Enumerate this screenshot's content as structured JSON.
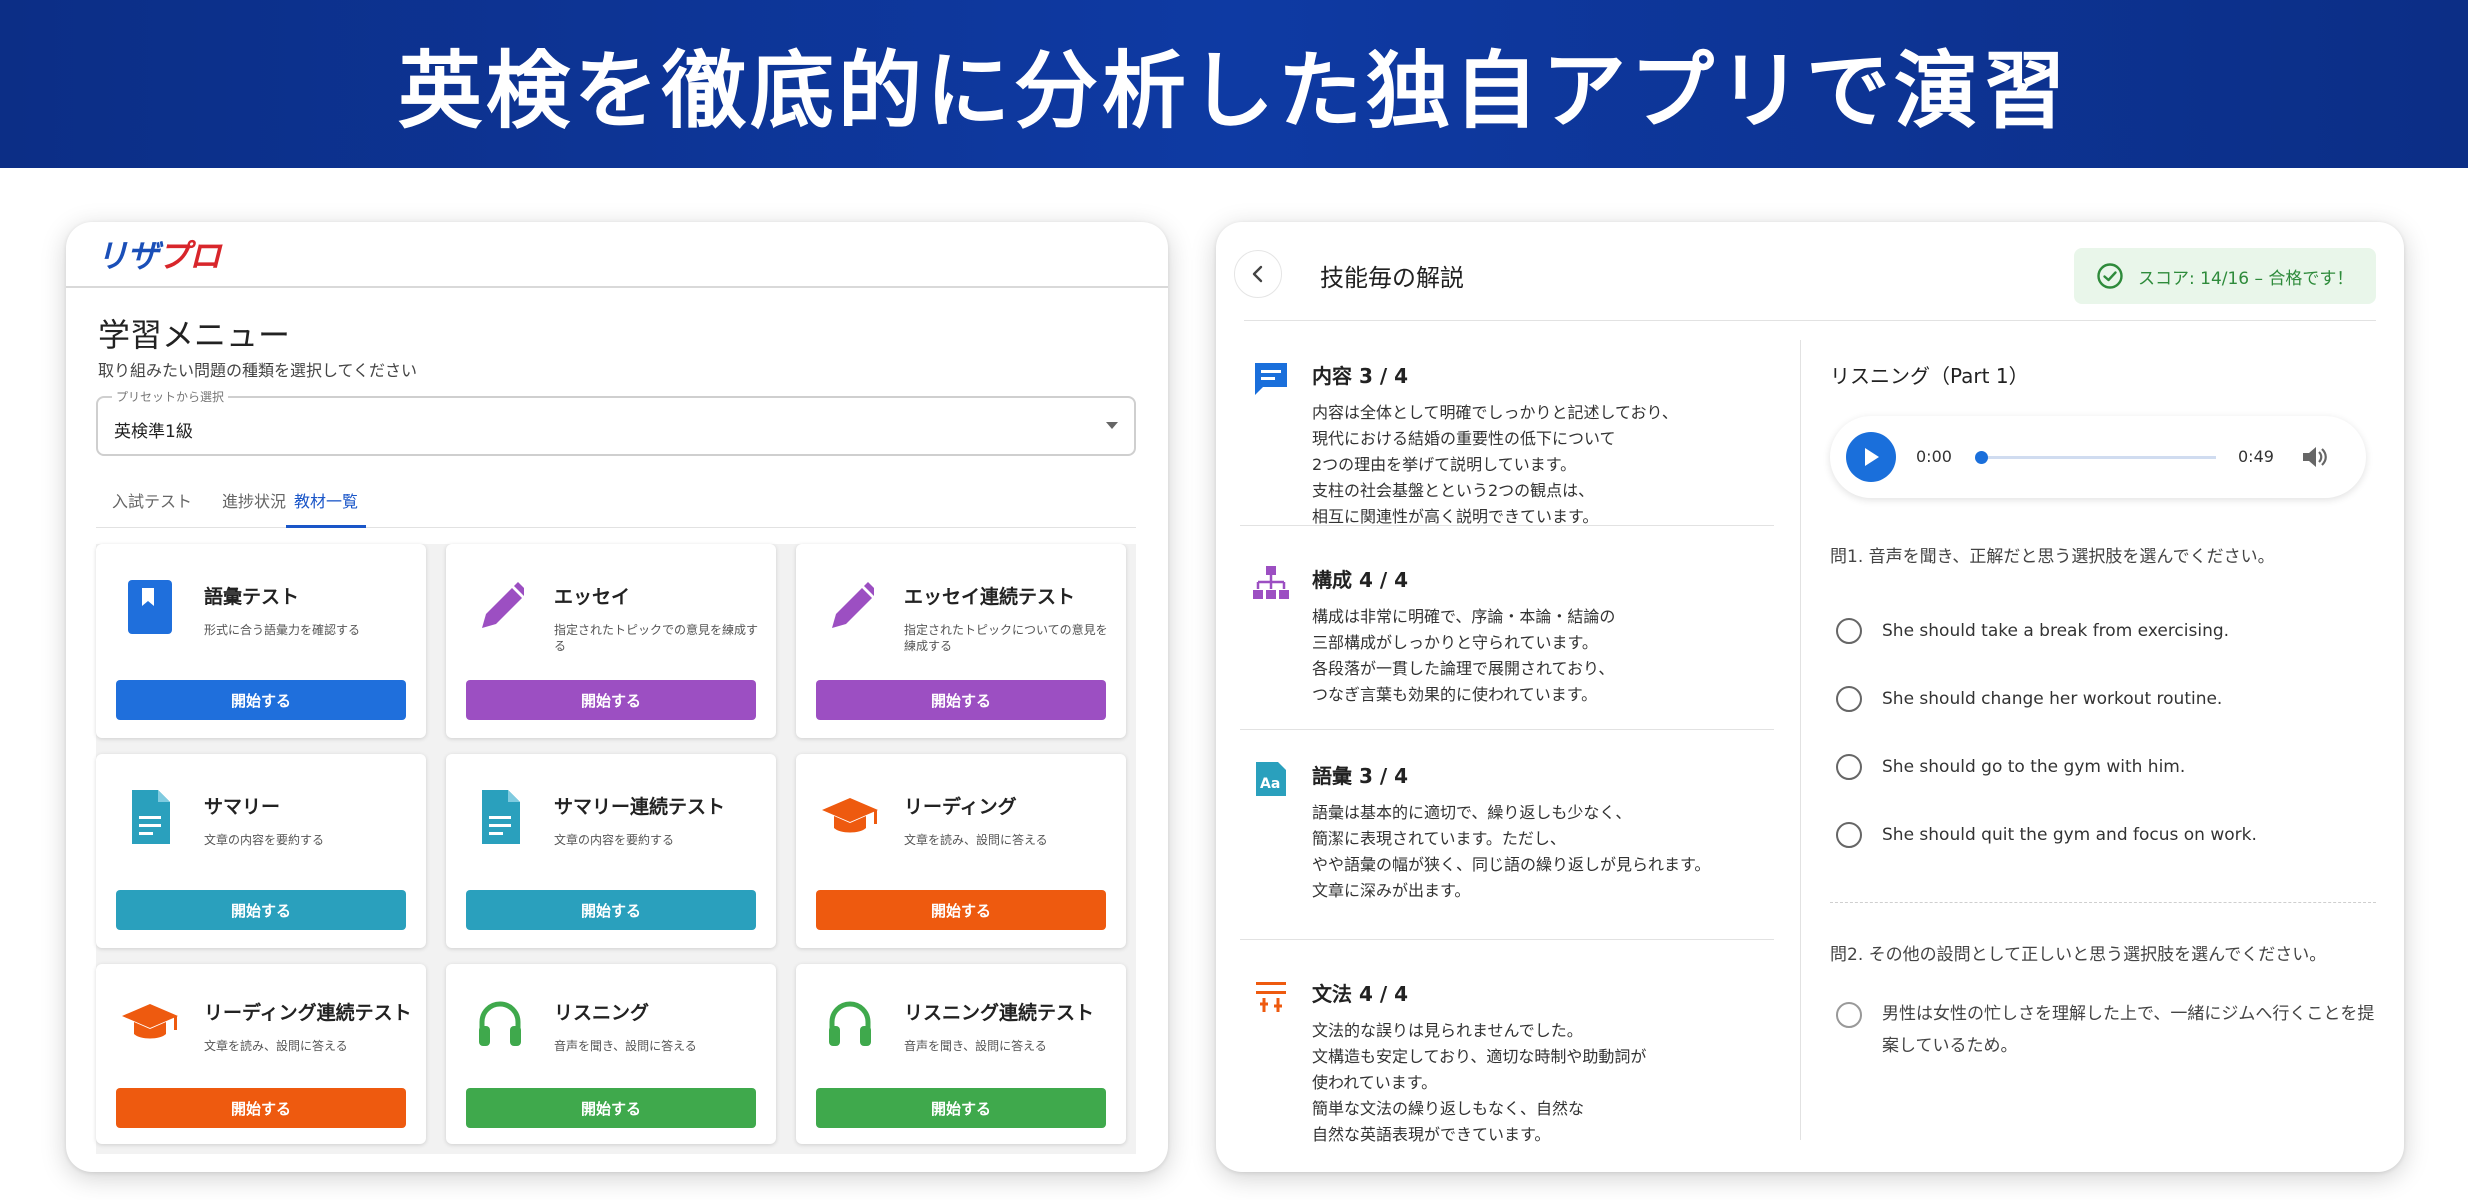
{
  "banner": {
    "title": "英検を徹底的に分析した独自アプリで演習"
  },
  "left": {
    "logo": {
      "part1": "リザ",
      "part2": "プロ"
    },
    "menu_title": "学習メニュー",
    "menu_subtitle": "取り組みたい問題の種類を選択してください",
    "select": {
      "legend": "プリセットから選択",
      "value": "英検準1級"
    },
    "tabs": [
      {
        "label": "入試テスト",
        "active": false
      },
      {
        "label": "進捗状況",
        "active": false
      },
      {
        "label": "教材一覧",
        "active": true
      }
    ],
    "cards": [
      {
        "title": "語彙テスト",
        "desc": "形式に合う語彙力を確認する",
        "button": "開始する",
        "icon": "book-icon",
        "color": "#1f6fdc"
      },
      {
        "title": "エッセイ",
        "desc": "指定されたトピックでの意見を練成する",
        "button": "開始する",
        "icon": "pencil-icon",
        "color": "#9c4fc2"
      },
      {
        "title": "エッセイ連続テスト",
        "desc": "指定されたトピックについての意見を練成する",
        "button": "開始する",
        "icon": "pencil-icon",
        "color": "#9c4fc2"
      },
      {
        "title": "サマリー",
        "desc": "文章の内容を要約する",
        "button": "開始する",
        "icon": "document-icon",
        "color": "#2aa0bd"
      },
      {
        "title": "サマリー連続テスト",
        "desc": "文章の内容を要約する",
        "button": "開始する",
        "icon": "document-icon",
        "color": "#2aa0bd"
      },
      {
        "title": "リーディング",
        "desc": "文章を読み、設問に答える",
        "button": "開始する",
        "icon": "graduation-cap-icon",
        "color": "#ee5a0f"
      },
      {
        "title": "リーディング連続テスト",
        "desc": "文章を読み、設問に答える",
        "button": "開始する",
        "icon": "graduation-cap-icon",
        "color": "#ee5a0f"
      },
      {
        "title": "リスニング",
        "desc": "音声を聞き、設問に答える",
        "button": "開始する",
        "icon": "headphones-icon",
        "color": "#3fa94c"
      },
      {
        "title": "リスニング連続テスト",
        "desc": "音声を聞き、設問に答える",
        "button": "開始する",
        "icon": "headphones-icon",
        "color": "#3fa94c"
      }
    ]
  },
  "right": {
    "title": "技能毎の解説",
    "score": "スコア: 14/16 – 合格です！",
    "skills": [
      {
        "title": "内容 3 / 4",
        "icon": "comment-icon",
        "color": "#1a6fdb",
        "lines": [
          "内容は全体として明確でしっかりと記述しており、",
          "現代における結婚の重要性の低下について",
          "2つの理由を挙げて説明しています。",
          "支柱の社会基盤とという2つの観点は、",
          "相互に関連性が高く説明できています。"
        ]
      },
      {
        "title": "構成 4 / 4",
        "icon": "hierarchy-icon",
        "color": "#9c4fc2",
        "lines": [
          "構成は非常に明確で、序論・本論・結論の",
          "三部構成がしっかりと守られています。",
          "各段落が一貫した論理で展開されており、",
          "つなぎ言葉も効果的に使われています。"
        ]
      },
      {
        "title": "語彙 3 / 4",
        "icon": "font-size-icon",
        "color": "#2aa0bd",
        "lines": [
          "語彙は基本的に適切で、繰り返しも少なく、",
          "簡潔に表現されています。ただし、",
          "やや語彙の幅が狭く、同じ語の繰り返しが見られます。",
          "文章に深みが出ます。"
        ]
      },
      {
        "title": "文法 4 / 4",
        "icon": "grammar-icon",
        "color": "#ee5a0f",
        "lines": [
          "文法的な誤りは見られませんでした。",
          "文構造も安定しており、適切な時制や助動詞が",
          "使われています。",
          "簡単な文法の繰り返しもなく、自然な",
          "自然な英語表現ができています。"
        ]
      }
    ],
    "listening": {
      "title": "リスニング（Part 1）",
      "current_time": "0:00",
      "total_time": "0:49",
      "progress": 0.0,
      "q1": "問1. 音声を聞き、正解だと思う選択肢を選んでください。",
      "options": [
        "She should take a break from exercising.",
        "She should change her workout routine.",
        "She should go to the gym with him.",
        "She should quit the gym and focus on work."
      ],
      "q2": "問2. その他の設問として正しいと思う選択肢を選んでください。",
      "q2_option": "男性は女性の忙しさを理解した上で、一緒にジムへ行くことを提案しているため。"
    }
  }
}
